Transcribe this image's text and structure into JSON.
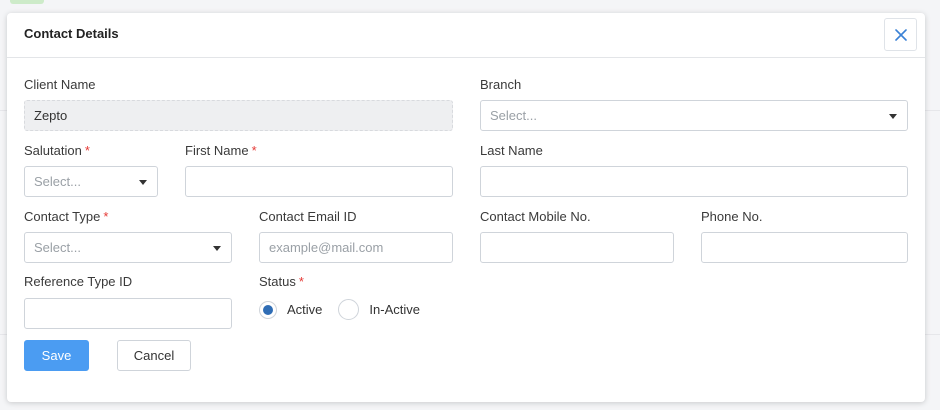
{
  "modal": {
    "title": "Contact Details",
    "close_icon": "close-icon"
  },
  "fields": {
    "client_name": {
      "label": "Client Name",
      "value": "Zepto"
    },
    "branch": {
      "label": "Branch",
      "placeholder": "Select..."
    },
    "salutation": {
      "label": "Salutation",
      "required": "*",
      "placeholder": "Select..."
    },
    "first_name": {
      "label": "First Name",
      "required": "*",
      "value": ""
    },
    "last_name": {
      "label": "Last Name",
      "value": ""
    },
    "contact_type": {
      "label": "Contact Type",
      "required": "*",
      "placeholder": "Select..."
    },
    "contact_email": {
      "label": "Contact Email ID",
      "placeholder": "example@mail.com"
    },
    "contact_mobile": {
      "label": "Contact Mobile No.",
      "value": ""
    },
    "phone": {
      "label": "Phone No.",
      "value": ""
    },
    "reference_type": {
      "label": "Reference Type ID",
      "value": ""
    },
    "status": {
      "label": "Status",
      "required": "*",
      "options": [
        "Active",
        "In-Active"
      ],
      "selected": "Active"
    }
  },
  "actions": {
    "save_label": "Save",
    "cancel_label": "Cancel"
  },
  "colors": {
    "primary": "#4b9cf2",
    "required": "#e53935",
    "radio_selected": "#2f6db5"
  }
}
